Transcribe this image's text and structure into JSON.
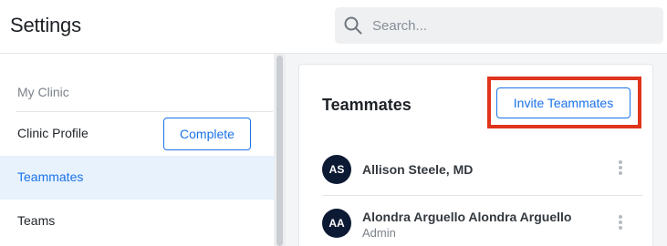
{
  "header": {
    "title": "Settings",
    "search_placeholder": "Search..."
  },
  "sidebar": {
    "section_label": "My Clinic",
    "items": [
      {
        "label": "Clinic Profile",
        "action_label": "Complete"
      },
      {
        "label": "Teammates",
        "active": true
      },
      {
        "label": "Teams"
      }
    ]
  },
  "teammates": {
    "title": "Teammates",
    "invite_label": "Invite Teammates",
    "members": [
      {
        "initials": "AS",
        "name": "Allison Steele, MD",
        "role": ""
      },
      {
        "initials": "AA",
        "name": "Alondra Arguello Alondra Arguello",
        "role": "Admin"
      }
    ]
  },
  "colors": {
    "accent": "#1a73e8",
    "highlight": "#e0341c",
    "avatar_bg": "#0c1a34"
  }
}
